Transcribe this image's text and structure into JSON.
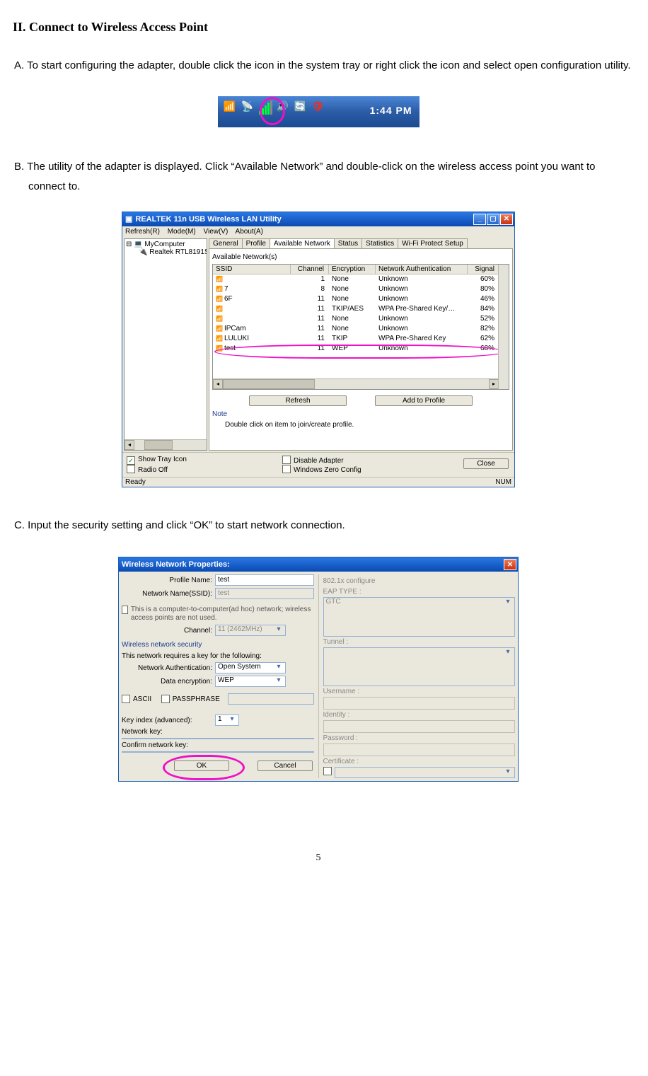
{
  "heading": "II.   Connect to Wireless Access Point",
  "step_a": "A. To start configuring the adapter, double click the icon in the system tray or right click the icon and select open configuration utility.",
  "step_b": "B. The utility of the adapter is displayed. Click “Available Network” and double-click on the wireless access point you want to connect to.",
  "step_c": "C. Input the security setting and click “OK” to start network connection.",
  "tray": {
    "time": "1:44 PM"
  },
  "app": {
    "title": "REALTEK 11n USB Wireless LAN Utility",
    "menu": {
      "refresh": "Refresh(R)",
      "mode": "Mode(M)",
      "view": "View(V)",
      "about": "About(A)"
    },
    "tree": {
      "root": "MyComputer",
      "child": "Realtek RTL8191SU"
    },
    "tabs": {
      "general": "General",
      "profile": "Profile",
      "available": "Available Network",
      "status": "Status",
      "statistics": "Statistics",
      "wps": "Wi-Fi Protect Setup"
    },
    "subtitle": "Available Network(s)",
    "cols": {
      "ssid": "SSID",
      "chan": "Channel",
      "enc": "Encryption",
      "auth": "Network Authentication",
      "sig": "Signal"
    },
    "rows": [
      {
        "ssid": "",
        "chan": "1",
        "enc": "None",
        "auth": "Unknown",
        "sig": "60%"
      },
      {
        "ssid": "7",
        "chan": "8",
        "enc": "None",
        "auth": "Unknown",
        "sig": "80%"
      },
      {
        "ssid": "6F",
        "chan": "11",
        "enc": "None",
        "auth": "Unknown",
        "sig": "46%"
      },
      {
        "ssid": "",
        "chan": "11",
        "enc": "TKIP/AES",
        "auth": "WPA Pre-Shared Key/…",
        "sig": "84%"
      },
      {
        "ssid": "",
        "chan": "11",
        "enc": "None",
        "auth": "Unknown",
        "sig": "52%"
      },
      {
        "ssid": "IPCam",
        "chan": "11",
        "enc": "None",
        "auth": "Unknown",
        "sig": "82%"
      },
      {
        "ssid": "LULUKI",
        "chan": "11",
        "enc": "TKIP",
        "auth": "WPA Pre-Shared Key",
        "sig": "62%"
      },
      {
        "ssid": "test",
        "chan": "11",
        "enc": "WEP",
        "auth": "Unknown",
        "sig": "68%"
      }
    ],
    "buttons": {
      "refresh": "Refresh",
      "add": "Add to Profile"
    },
    "note_title": "Note",
    "note_text": "Double click on item to join/create profile.",
    "opts": {
      "show_tray": "Show Tray Icon",
      "radio_off": "Radio Off",
      "disable": "Disable Adapter",
      "zero": "Windows Zero Config"
    },
    "close": "Close",
    "status": {
      "ready": "Ready",
      "num": "NUM"
    }
  },
  "prop": {
    "title": "Wireless Network Properties:",
    "labels": {
      "profile_name": "Profile Name:",
      "ssid": "Network Name(SSID):",
      "adhoc": "This is a computer-to-computer(ad hoc) network; wireless access points are not used.",
      "channel": "Channel:",
      "sec_title": "Wireless network security",
      "sec_desc": "This network requires a key for the following:",
      "auth": "Network Authentication:",
      "enc": "Data encryption:",
      "ascii": "ASCII",
      "pass": "PASSPHRASE",
      "keyidx": "Key index (advanced):",
      "netkey": "Network key:",
      "confirm": "Confirm network key:",
      "cfg8021x": "802.1x configure",
      "eap": "EAP TYPE :",
      "tunnel": "Tunnel :",
      "user": "Username :",
      "identity": "Identity :",
      "password": "Password :",
      "cert": "Certificate :"
    },
    "values": {
      "profile_name": "test",
      "ssid": "test",
      "channel": "11 (2462MHz)",
      "auth": "Open System",
      "enc": "WEP",
      "keyidx": "1",
      "eap": "GTC"
    },
    "buttons": {
      "ok": "OK",
      "cancel": "Cancel"
    }
  },
  "page_number": "5"
}
